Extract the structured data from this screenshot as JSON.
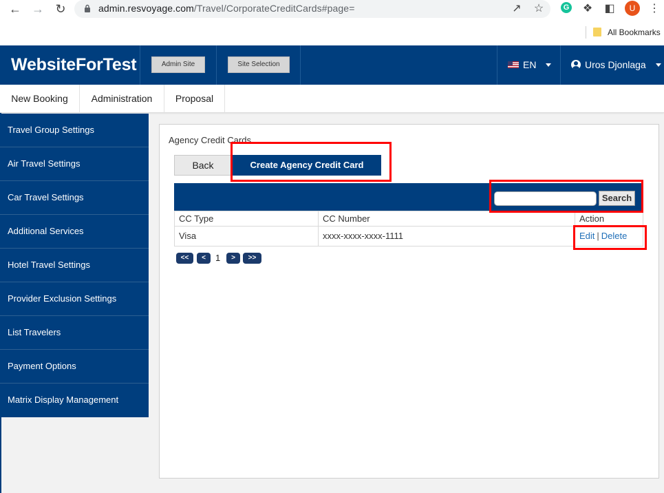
{
  "browser": {
    "url_domain": "admin.resvoyage.com",
    "url_path": "/Travel/CorporateCreditCards#page=",
    "bookmarks_label": "All Bookmarks",
    "avatar_letter": "U",
    "grammarly_letter": "G"
  },
  "header": {
    "logo": "WebsiteForTest",
    "admin_site_label": "Admin Site",
    "site_selection_label": "Site Selection",
    "language": "EN",
    "user_name": "Uros Djonlaga"
  },
  "menu": {
    "items": [
      {
        "label": "New Booking"
      },
      {
        "label": "Administration"
      },
      {
        "label": "Proposal"
      }
    ]
  },
  "sidebar": {
    "items": [
      {
        "label": "Travel Group Settings"
      },
      {
        "label": "Air Travel Settings"
      },
      {
        "label": "Car Travel Settings"
      },
      {
        "label": "Additional Services"
      },
      {
        "label": "Hotel Travel Settings"
      },
      {
        "label": "Provider Exclusion Settings"
      },
      {
        "label": "List Travelers"
      },
      {
        "label": "Payment Options"
      },
      {
        "label": "Matrix Display Management"
      }
    ]
  },
  "main": {
    "title": "Agency Credit Cards",
    "back_label": "Back",
    "create_label": "Create Agency Credit Card",
    "search": {
      "value": "",
      "button_label": "Search"
    },
    "columns": [
      "CC Type",
      "CC Number",
      "Action"
    ],
    "rows": [
      {
        "cc_type": "Visa",
        "cc_number": "xxxx-xxxx-xxxx-1111",
        "edit_label": "Edit",
        "separator": "|",
        "delete_label": "Delete"
      }
    ],
    "pagination": {
      "first": "<<",
      "prev": "<",
      "current": "1",
      "next": ">",
      "last": ">>"
    }
  },
  "colors": {
    "brand": "#003e7e",
    "highlight": "#ff0000",
    "link": "#1f6fb8"
  }
}
